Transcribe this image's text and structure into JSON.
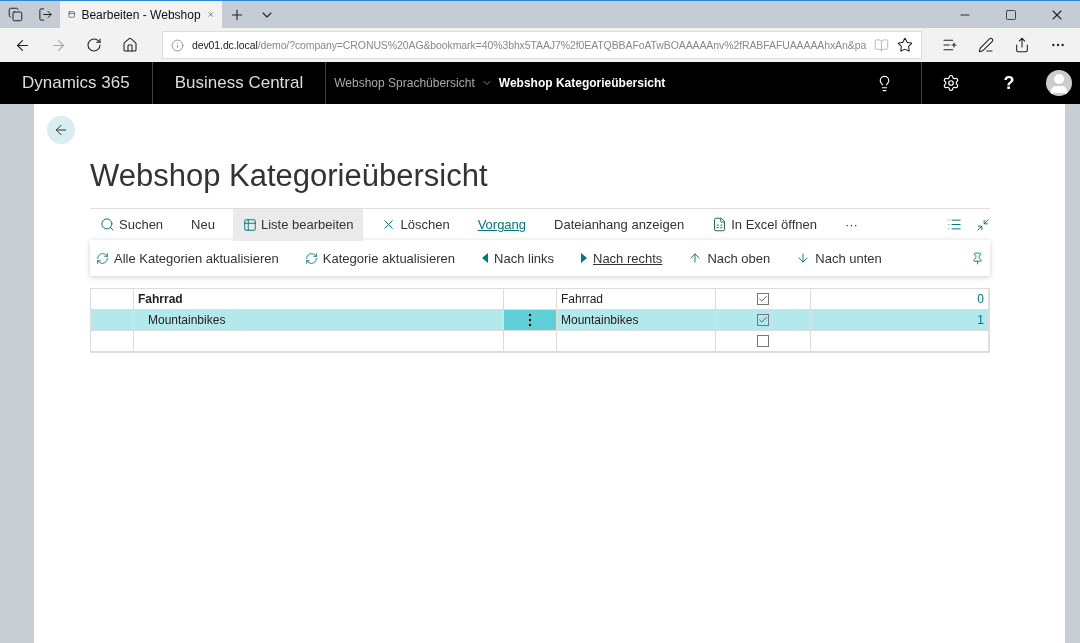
{
  "browser": {
    "tab_title": "Bearbeiten - Webshop",
    "address": {
      "host": "dev01.dc.local",
      "path": "/demo/?company=CRONUS%20AG&bookmark=40%3bhx5TAAJ7%2f0EATQBBAFoATwBOAAAAAnv%2fRABFAFUAAAAAhxAn&pa"
    }
  },
  "app_bar": {
    "product": "Dynamics 365",
    "app": "Business Central",
    "help": "?",
    "breadcrumbs": [
      {
        "label": "Webshop Sprachübersicht",
        "selected": false
      },
      {
        "label": "Webshop Kategorieübersicht",
        "selected": true
      }
    ]
  },
  "page": {
    "title": "Webshop Kategorieübersicht"
  },
  "actions": [
    {
      "label": "Suchen",
      "kind": "search",
      "selected": false
    },
    {
      "label": "Neu",
      "kind": "plain",
      "selected": false
    },
    {
      "label": "Liste bearbeiten",
      "kind": "edit",
      "selected": false
    },
    {
      "label": "Löschen",
      "kind": "delete",
      "selected": false
    },
    {
      "label": "Vorgang",
      "kind": "plain",
      "selected": true
    },
    {
      "label": "Dateianhang anzeigen",
      "kind": "plain",
      "selected": false
    },
    {
      "label": "In Excel öffnen",
      "kind": "excel",
      "selected": false
    },
    {
      "label": "···",
      "kind": "more",
      "selected": false
    }
  ],
  "sub_actions": [
    {
      "label": "Alle Kategorien aktualisieren",
      "kind": "refresh",
      "selected": false
    },
    {
      "label": "Kategorie aktualisieren",
      "kind": "refresh",
      "selected": false
    },
    {
      "label": "Nach links",
      "kind": "left",
      "selected": false
    },
    {
      "label": "Nach rechts",
      "kind": "right",
      "selected": true
    },
    {
      "label": "Nach oben",
      "kind": "up",
      "selected": false
    },
    {
      "label": "Nach unten",
      "kind": "down",
      "selected": false
    }
  ],
  "rows": [
    {
      "name": "Fahrrad",
      "description": "Fahrrad",
      "checked": true,
      "count": "0",
      "selected": false,
      "children": [
        {
          "name": "Mountainbikes",
          "description": "Mountainbikes",
          "checked": true,
          "count": "1",
          "selected": true
        }
      ]
    },
    {
      "checked": false,
      "selected": false
    }
  ]
}
